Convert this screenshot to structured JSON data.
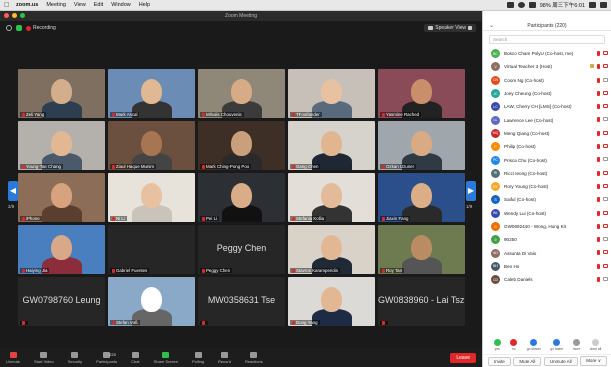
{
  "menubar": {
    "app": "zoom.us",
    "items": [
      "Meeting",
      "View",
      "Edit",
      "Window",
      "Help"
    ],
    "status": "98%  周三下午6:01"
  },
  "window": {
    "title": "Zoom Meeting"
  },
  "meeting": {
    "recording_label": "Recording",
    "view_label": "Speaker View"
  },
  "grid": {
    "page_left": "2/9",
    "page_right": "1/9",
    "tiles": [
      {
        "name": "Zeli Yang",
        "kind": "video",
        "bg": "#7e6f60",
        "skin": "#d4ad8c",
        "shirt": "#2c3e50"
      },
      {
        "name": "Mark Ascal",
        "kind": "video",
        "bg": "#6b8cb5",
        "skin": "#e0b893",
        "shirt": "#333"
      },
      {
        "name": "Mihalis Chouvenis",
        "kind": "video",
        "bg": "#8f8777",
        "skin": "#d8ab87",
        "shirt": "#3b3b3b"
      },
      {
        "name": "TFootlander",
        "kind": "video",
        "bg": "#c7c0b8",
        "skin": "#e8c2a0",
        "shirt": "#596a7c"
      },
      {
        "name": "Yasmine Rached",
        "kind": "video",
        "bg": "#8a4b58",
        "skin": "#c98f6a",
        "shirt": "#222"
      },
      {
        "name": "Young-Tae Chang",
        "kind": "video",
        "bg": "#b4b1ad",
        "skin": "#e2b894",
        "shirt": "#4b5a6a"
      },
      {
        "name": "Ziaul Haque Munim",
        "kind": "video",
        "bg": "#6b5040",
        "skin": "#a87552",
        "shirt": "#444"
      },
      {
        "name": "Mark Ching-Pong Poo",
        "kind": "video",
        "bg": "#3d2f26",
        "skin": "#caa07c",
        "shirt": "#2a2a2a"
      },
      {
        "name": "Gang Chen",
        "kind": "video",
        "bg": "#d6d3cc",
        "skin": "#e0b58f",
        "shirt": "#1e2733"
      },
      {
        "name": "Ozkan Uzuner",
        "kind": "video",
        "bg": "#9fa7ad",
        "skin": "#d9ab85",
        "shirt": "#303a44"
      },
      {
        "name": "iPhone",
        "kind": "video",
        "bg": "#8c6d57",
        "skin": "#d6a37e",
        "shirt": "#5a3f2f"
      },
      {
        "name": "Ni Li",
        "kind": "video",
        "bg": "#e7e2da",
        "skin": "#e7c1a0",
        "shirt": "#c9c3ba"
      },
      {
        "name": "Pei Li",
        "kind": "video",
        "bg": "#2c2f33",
        "skin": "#d8ad88",
        "shirt": "#111"
      },
      {
        "name": "Stefania Kollia",
        "kind": "video",
        "bg": "#e3ded7",
        "skin": "#e3bb98",
        "shirt": "#333"
      },
      {
        "name": "Jiaxin Fang",
        "kind": "video",
        "bg": "#2b4f8a",
        "skin": "#dcae88",
        "shirt": "#2a2a2a"
      },
      {
        "name": "Haiying Jia",
        "kind": "video",
        "bg": "#4a7fbf",
        "skin": "#d8a888",
        "shirt": "#8b2d3a"
      },
      {
        "name": "Gabriel Fuentes",
        "kind": "blank",
        "big": ""
      },
      {
        "name": "Peggy Chen",
        "kind": "blank",
        "big": "Peggy Chen"
      },
      {
        "name": "Stavros Karamperidis",
        "kind": "video",
        "bg": "#d9d2c8",
        "skin": "#e2b894",
        "shirt": "#1f2a36"
      },
      {
        "name": "Roy Tan",
        "kind": "video",
        "bg": "#6e7a4f",
        "skin": "#b98c63",
        "shirt": "#555"
      },
      {
        "name": "",
        "kind": "blank",
        "big": "GW0798760 Leung"
      },
      {
        "name": "Stefan Voß",
        "kind": "video",
        "bg": "#8aa9c9",
        "skin": "#ffffff",
        "shirt": "#666"
      },
      {
        "name": "",
        "kind": "blank",
        "big": "MW0358631 Tse"
      },
      {
        "name": "Dong Yang",
        "kind": "video",
        "bg": "#dcdad6",
        "skin": "#e2b894",
        "shirt": "#1d2b44"
      },
      {
        "name": "",
        "kind": "blank",
        "big": "GW0838960 - Lai Tsz..."
      }
    ]
  },
  "toolbar": {
    "items": [
      {
        "label": "Unmute",
        "icon": "microphone-icon"
      },
      {
        "label": "Start Video",
        "icon": "video-camera-icon"
      },
      {
        "label": "Security",
        "icon": "shield-icon"
      },
      {
        "label": "Participants",
        "icon": "participants-icon",
        "count": "220"
      },
      {
        "label": "Chat",
        "icon": "chat-icon"
      },
      {
        "label": "Share Screen",
        "icon": "share-screen-icon"
      },
      {
        "label": "Polling",
        "icon": "polling-icon"
      },
      {
        "label": "Record",
        "icon": "record-icon"
      },
      {
        "label": "Reactions",
        "icon": "reactions-icon"
      }
    ],
    "leave_label": "Leave"
  },
  "participants_panel": {
    "title": "Participants (220)",
    "search_placeholder": "Search",
    "rows": [
      {
        "name": "Bosco Cham PolyU (Co-host, me)",
        "initials": "BC",
        "color": "#4caf50"
      },
      {
        "name": "Virtual Teacher 3 (Host)",
        "initials": "V",
        "color": "#8d6e63"
      },
      {
        "name": "Coom Ng (Co-host)",
        "initials": "CN",
        "color": "#e64a19"
      },
      {
        "name": "Joey Cheung (Co-host)",
        "initials": "JC",
        "color": "#26a69a"
      },
      {
        "name": "LAW, Cherry CH [LMS] (Co-host)",
        "initials": "LC",
        "color": "#3949ab"
      },
      {
        "name": "Lawrence Lee (Co-host)",
        "initials": "LL",
        "color": "#5c6bc0"
      },
      {
        "name": "Meng Qiang (Co-host)",
        "initials": "MQ",
        "color": "#c62828"
      },
      {
        "name": "Philip (Co-host)",
        "initials": "P",
        "color": "#fb8c00"
      },
      {
        "name": "Prisca Chu  (Co-host)",
        "initials": "PC",
        "color": "#1e88e5"
      },
      {
        "name": "Ricci Ieong (Co-host)",
        "initials": "RI",
        "color": "#546e7a"
      },
      {
        "name": "Rory Young (Co-host)",
        "initials": "RY",
        "color": "#f9a825"
      },
      {
        "name": "Saiful (Co-host)",
        "initials": "S",
        "color": "#1565c0"
      },
      {
        "name": "Wendy Lui (Co-host)",
        "initials": "WL",
        "color": "#3949ab"
      },
      {
        "name": "GW0692440 - Wong, Hung Kit",
        "initials": "G",
        "color": "#ef6c00"
      },
      {
        "name": "90250",
        "initials": "9",
        "color": "#43a047"
      },
      {
        "name": "Assunta Di Vaio",
        "initials": "AD",
        "color": "#8d6e63"
      },
      {
        "name": "Ben Ho",
        "initials": "BH",
        "color": "#455a64"
      },
      {
        "name": "Caleb Daniels",
        "initials": "CD",
        "color": "#6d4c41"
      }
    ],
    "reactions": [
      {
        "label": "yes",
        "color": "#2fbf4d"
      },
      {
        "label": "no",
        "color": "#e02828"
      },
      {
        "label": "go slower",
        "color": "#2a7bd9"
      },
      {
        "label": "go faster",
        "color": "#2a7bd9"
      },
      {
        "label": "more",
        "color": "#999999"
      },
      {
        "label": "clear all",
        "color": "#cccccc"
      }
    ],
    "footer": {
      "invite": "Invite",
      "mute_all": "Mute All",
      "unmute_all": "Unmute All",
      "more": "More ∨"
    }
  }
}
